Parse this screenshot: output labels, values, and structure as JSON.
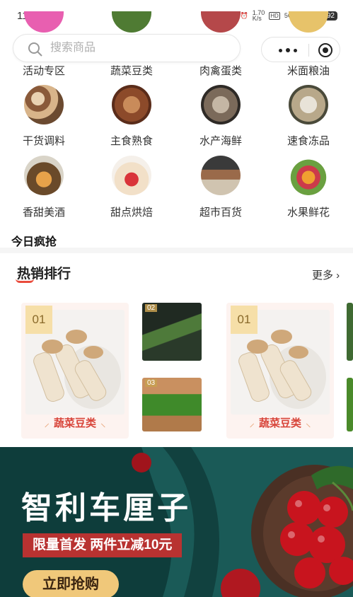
{
  "status_bar": {
    "time": "11:24",
    "network_speed": "1.70\nK/s",
    "signal_1": "5G",
    "signal_2": "5G",
    "battery": "92"
  },
  "search": {
    "placeholder": "搜索商品"
  },
  "categories": [
    {
      "label": "活动专区",
      "icon": "activity-icon"
    },
    {
      "label": "蔬菜豆类",
      "icon": "vegetable-icon"
    },
    {
      "label": "肉禽蛋类",
      "icon": "meat-icon"
    },
    {
      "label": "米面粮油",
      "icon": "grain-icon"
    },
    {
      "label": "干货调料",
      "icon": "dry-goods-icon"
    },
    {
      "label": "主食熟食",
      "icon": "cooked-food-icon"
    },
    {
      "label": "水产海鲜",
      "icon": "seafood-icon"
    },
    {
      "label": "速食冻品",
      "icon": "frozen-food-icon"
    },
    {
      "label": "香甜美酒",
      "icon": "wine-icon"
    },
    {
      "label": "甜点烘焙",
      "icon": "dessert-icon"
    },
    {
      "label": "超市百货",
      "icon": "supermarket-icon"
    },
    {
      "label": "水果鲜花",
      "icon": "fruit-icon"
    }
  ],
  "today_section": {
    "title": "今日疯抢"
  },
  "hot_sales": {
    "title": "热销排行",
    "more_label": "更多",
    "cards": [
      {
        "rank": "01",
        "category": "蔬菜豆类"
      },
      {
        "rank": "01",
        "category": "蔬菜豆类"
      }
    ],
    "mini_cards": [
      {
        "rank": "02"
      },
      {
        "rank": "03"
      }
    ]
  },
  "banner": {
    "title": "智利车厘子",
    "subtitle": "限量首发 两件立减10元",
    "button_label": "立即抢购"
  }
}
